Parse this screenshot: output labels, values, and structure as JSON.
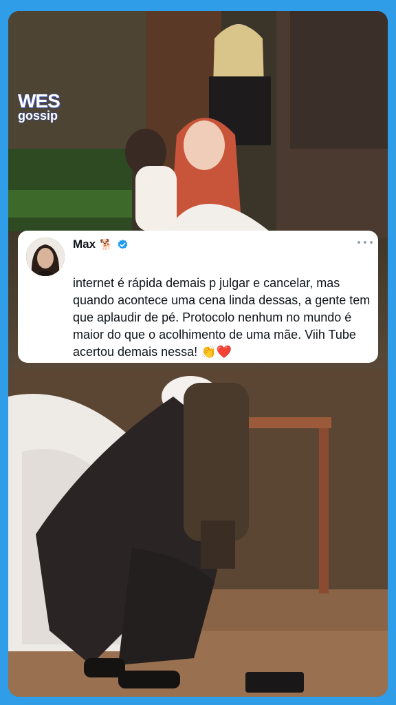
{
  "brand": {
    "line1": "WES",
    "line2": "gossip"
  },
  "post": {
    "author": "Max",
    "author_emoji": "🐕",
    "verified_icon": "verified-badge-icon",
    "menu_icon": "more-options-icon",
    "text": "internet é rápida demais p julgar e cancelar,  mas quando acontece uma cena linda dessas, a gente tem que aplaudir de pé. Protocolo nenhum no mundo é maior do que o acolhimento de uma mãe. Viih Tube acertou demais nessa! 👏❤️"
  },
  "colors": {
    "frame": "#2f9de8",
    "verified": "#1d9bf0",
    "card": "#ffffff"
  }
}
